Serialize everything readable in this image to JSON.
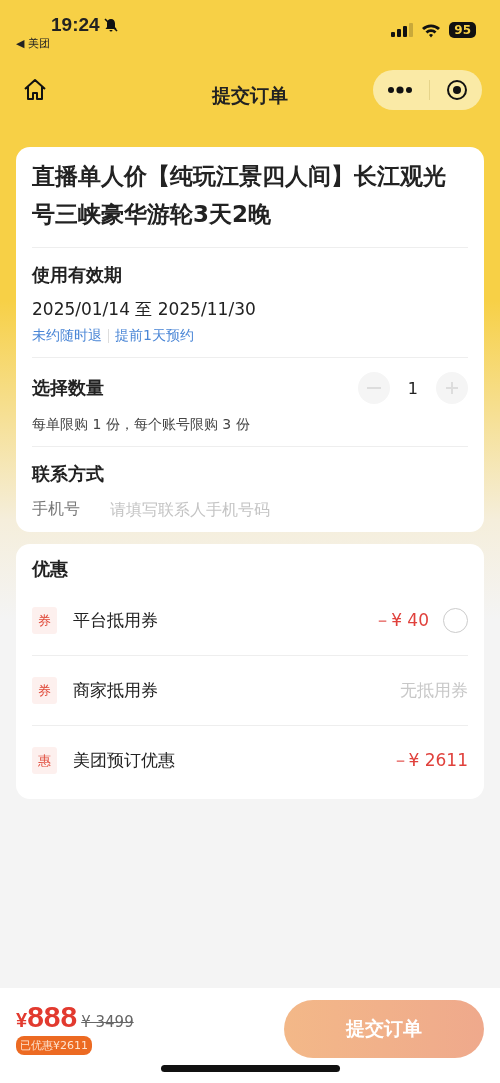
{
  "status_bar": {
    "time": "19:24",
    "back_app": "◀ 美团",
    "battery": "95"
  },
  "nav": {
    "title": "提交订单"
  },
  "product": {
    "title": "直播单人价【纯玩江景四人间】长江观光号三峡豪华游轮3天2晚"
  },
  "validity": {
    "label": "使用有效期",
    "dates": "2025/01/14 至 2025/11/30",
    "tags": [
      "未约随时退",
      "提前1天预约"
    ]
  },
  "quantity": {
    "label": "选择数量",
    "value": "1",
    "minus_disabled": true,
    "plus_disabled": true,
    "limit": "每单限购 1 份，每个账号限购 3 份"
  },
  "contact": {
    "label": "联系方式",
    "field_label": "手机号",
    "placeholder": "请填写联系人手机号码"
  },
  "discounts": {
    "title": "优惠",
    "items": [
      {
        "kind": "radio",
        "badge": "券",
        "name": "平台抵用券",
        "value": "－¥ 40",
        "checked": false
      },
      {
        "kind": "none",
        "badge": "券",
        "name": "商家抵用券",
        "value": "无抵用券"
      },
      {
        "kind": "amount",
        "badge": "惠",
        "name": "美团预订优惠",
        "value": "－¥ 2611"
      }
    ]
  },
  "footer": {
    "currency": "¥",
    "price": "888",
    "original_price": "¥ 3499",
    "saved": "已优惠¥2611",
    "submit": {
      "label": "提交订单",
      "disabled": true
    }
  }
}
